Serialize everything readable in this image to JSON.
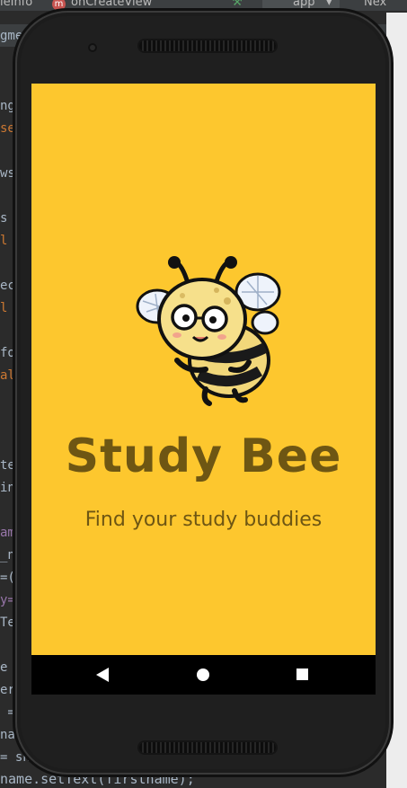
{
  "ide": {
    "file_tab": "leInfo",
    "method_icon": "m",
    "method_name": "onCreateView",
    "run_config": "app",
    "next_label": "Nex",
    "code_bottom": "name.setText(firstname);",
    "left_code": [
      {
        "text": "gme",
        "cls": ""
      },
      {
        "text": "ng",
        "cls": ""
      },
      {
        "text": "se",
        "cls": "kw"
      },
      {
        "text": "ws:",
        "cls": ""
      },
      {
        "text": "s c",
        "cls": ""
      },
      {
        "text": "l S",
        "cls": "kw"
      },
      {
        "text": "ect",
        "cls": ""
      },
      {
        "text": "l S",
        "cls": "kw"
      },
      {
        "text": "fo",
        "cls": ""
      },
      {
        "text": "al",
        "cls": "kw"
      },
      {
        "text": "teV",
        "cls": ""
      },
      {
        "text": "inf",
        "cls": ""
      },
      {
        "text": "ame",
        "cls": "pur"
      },
      {
        "text": "_na",
        "cls": ""
      },
      {
        "text": "=(T",
        "cls": ""
      },
      {
        "text": "y=",
        "cls": "pur"
      },
      {
        "text": "Tex",
        "cls": ""
      },
      {
        "text": "e d",
        "cls": ""
      },
      {
        "text": "ere",
        "cls": ""
      },
      {
        "text": " =",
        "cls": ""
      },
      {
        "text": "nam",
        "cls": ""
      },
      {
        "text": "= sh",
        "cls": ""
      }
    ]
  },
  "app": {
    "title": "Study Bee",
    "subtitle": "Find your study buddies",
    "bg_color": "#fdc72e",
    "text_color": "#6e5613"
  },
  "navbar": {
    "back_icon": "back-triangle-icon",
    "home_icon": "home-circle-icon",
    "recents_icon": "recents-square-icon"
  }
}
